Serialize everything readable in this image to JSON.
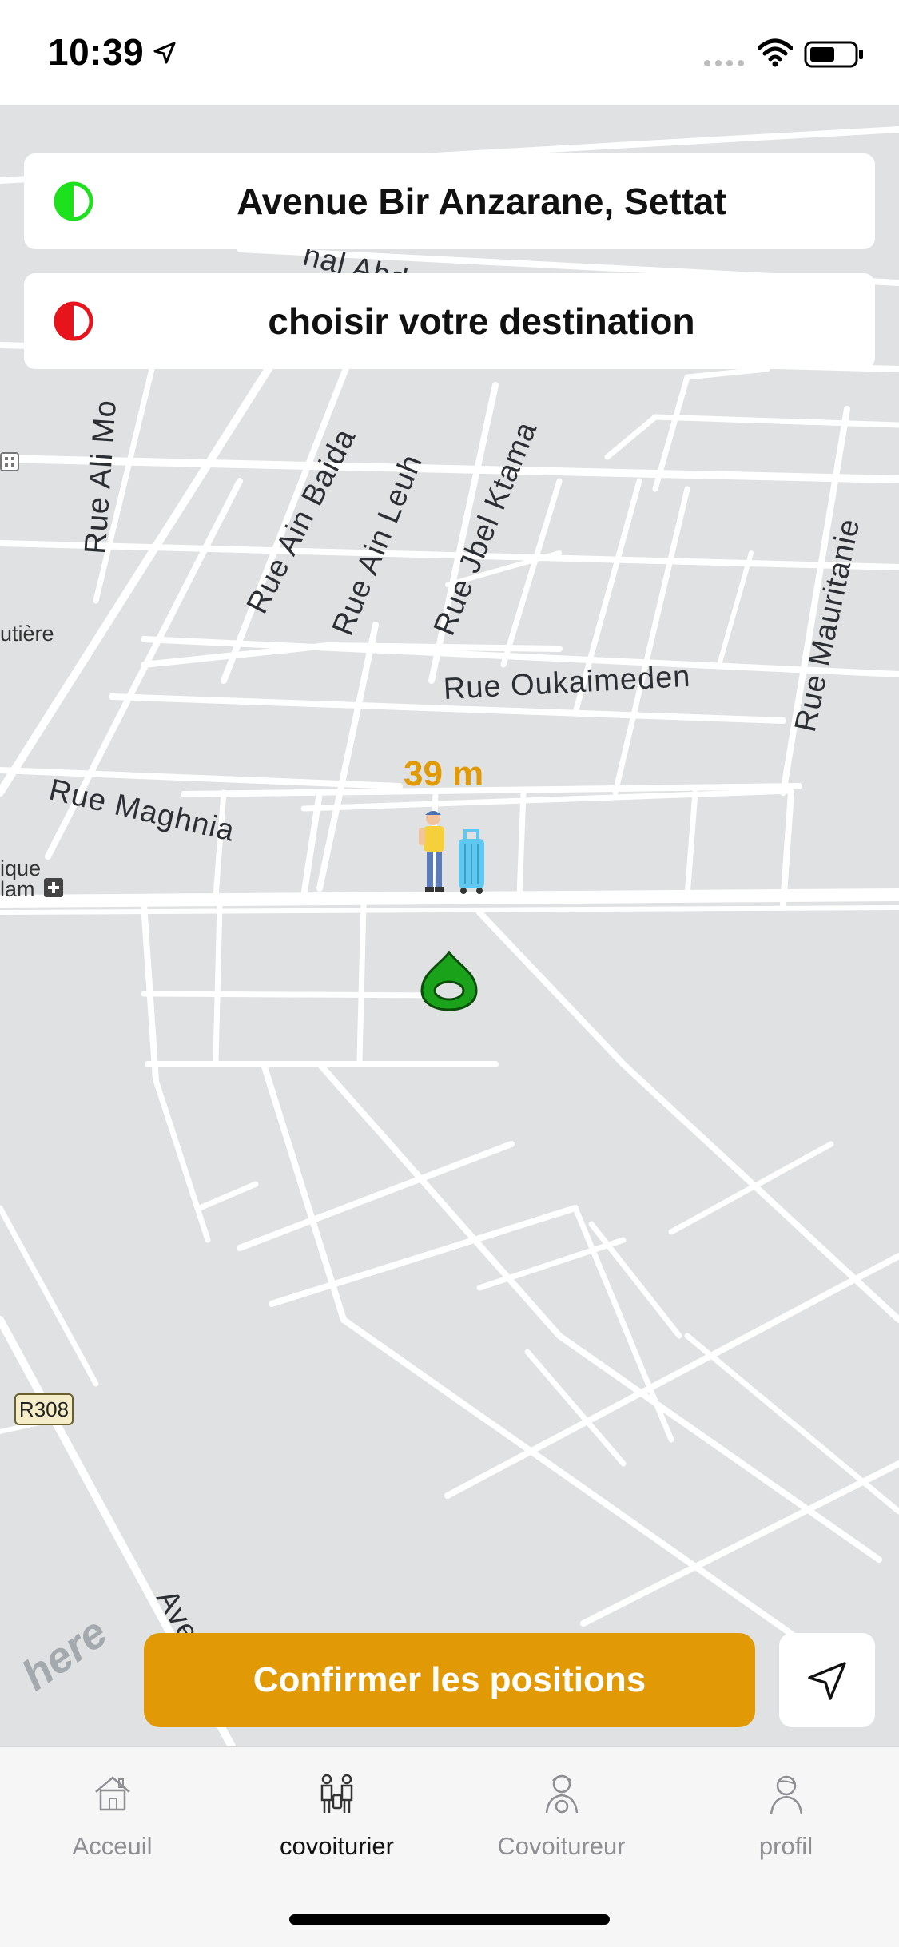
{
  "status_bar": {
    "time": "10:39"
  },
  "route": {
    "origin": "Avenue Bir Anzarane, Settat",
    "destination_placeholder": "choisir votre destination",
    "origin_color": "#1ee11e",
    "destination_color": "#e8141b"
  },
  "map": {
    "streets": [
      "Rue Ali Mo",
      "Rue Ain Baida",
      "Rue Ain Leuh",
      "Rue Jbel Ktama",
      "Rue Mauritanie",
      "Rue Oukaimeden",
      "Rue Maghnia",
      "Aven",
      "hal Abd"
    ],
    "edge_labels": [
      "utière",
      "ique",
      "lam"
    ],
    "road_number": "R308",
    "distance": "39 m",
    "attribution": "here"
  },
  "actions": {
    "confirm_label": "Confirmer les positions"
  },
  "tabs": [
    {
      "label": "Acceuil",
      "icon": "house-icon",
      "active": false
    },
    {
      "label": "covoiturier",
      "icon": "carpool-passengers-icon",
      "active": true
    },
    {
      "label": "Covoitureur",
      "icon": "driver-icon",
      "active": false
    },
    {
      "label": "profil",
      "icon": "profile-icon",
      "active": false
    }
  ],
  "colors": {
    "accent": "#e19a05",
    "map_bg": "#dfe1e2",
    "road": "#ffffff"
  }
}
